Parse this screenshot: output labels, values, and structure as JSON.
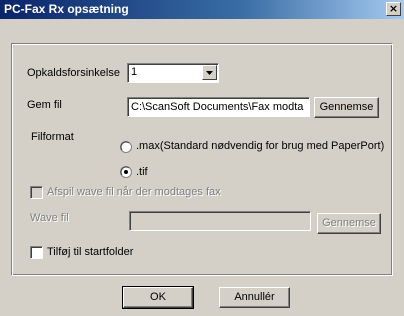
{
  "window": {
    "title": "PC-Fax Rx opsætning",
    "close_icon": "close-icon",
    "close_glyph": "×"
  },
  "dial_delay": {
    "label": "Opkaldsforsinkelse",
    "value": "1"
  },
  "save_file": {
    "label": "Gem fil",
    "path": "C:\\ScanSoft Documents\\Fax modta",
    "browse_label": "Gennemse"
  },
  "file_format": {
    "label": "Filformat",
    "options": [
      {
        "label": ".max(Standard nødvendig for brug med PaperPort)",
        "selected": false
      },
      {
        "label": ".tif",
        "selected": true
      }
    ]
  },
  "play_wave": {
    "label": "Afspil wave fil når der modtages fax",
    "checked": false,
    "enabled": false
  },
  "wave_file": {
    "label": "Wave fil",
    "path": "",
    "browse_label": "Gennemse",
    "enabled": false
  },
  "startup": {
    "label": "Tilføj til startfolder",
    "checked": false
  },
  "footer": {
    "ok_label": "OK",
    "cancel_label": "Annullér"
  }
}
